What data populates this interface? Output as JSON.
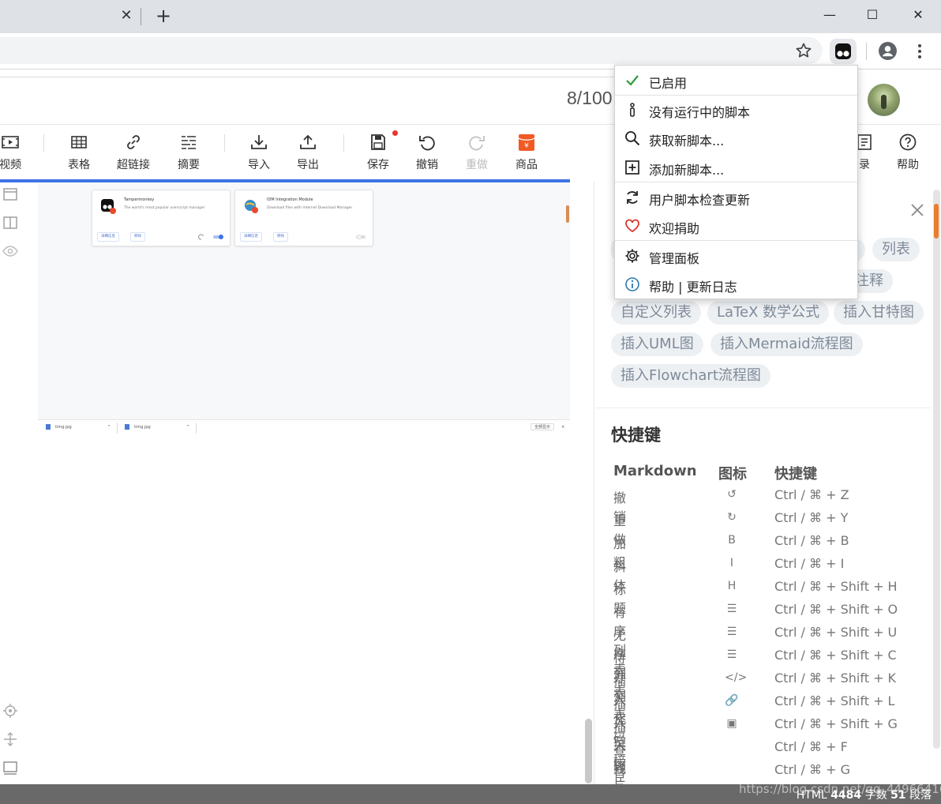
{
  "tab": {
    "close_glyph": "✕",
    "new_tab_glyph": "+"
  },
  "window": {
    "minimize": "—",
    "maximize": "☐",
    "close": "✕"
  },
  "editor": {
    "word_count": "8/100",
    "toolbar": [
      {
        "label": "视频",
        "icon": "video-icon"
      },
      {
        "label": "表格",
        "icon": "table-icon"
      },
      {
        "label": "超链接",
        "icon": "link-icon"
      },
      {
        "label": "摘要",
        "icon": "summary-icon"
      },
      {
        "label": "导入",
        "icon": "import-icon"
      },
      {
        "label": "导出",
        "icon": "export-icon"
      },
      {
        "label": "保存",
        "icon": "save-icon"
      },
      {
        "label": "撤销",
        "icon": "undo-icon"
      },
      {
        "label": "重做",
        "icon": "redo-icon"
      },
      {
        "label": "商品",
        "icon": "product-icon"
      },
      {
        "label": "录",
        "icon": "catalog-icon"
      },
      {
        "label": "帮助",
        "icon": "help-icon"
      }
    ],
    "accent_color": "#3f73e6"
  },
  "preview": {
    "cards": [
      {
        "name": "Tampermonkey",
        "desc": "The world's most popular userscript manager",
        "buttons": [
          "详细信息",
          "移除"
        ],
        "enabled": true
      },
      {
        "name": "IDM Integration Module",
        "desc": "Download files with Internet Download Manager",
        "buttons": [
          "详细信息",
          "移除"
        ],
        "enabled": false
      }
    ],
    "downloads": [
      "timg.jpg",
      "timg.jpg"
    ],
    "show_all": "全部显示"
  },
  "menu": {
    "items": [
      {
        "label": "已启用",
        "icon": "check-icon"
      },
      {
        "label": "没有运行中的脚本",
        "icon": "info-exclamation-icon"
      },
      {
        "label": "获取新脚本...",
        "icon": "search-icon"
      },
      {
        "label": "添加新脚本...",
        "icon": "add-box-icon"
      },
      {
        "label": "用户脚本检查更新",
        "icon": "refresh-icon"
      },
      {
        "label": "欢迎捐助",
        "icon": "heart-icon"
      },
      {
        "label": "管理面板",
        "icon": "gear-icon"
      },
      {
        "label": "帮助 | 更新日志",
        "icon": "info-circle-icon"
      }
    ]
  },
  "right_panel": {
    "chips": [
      {
        "label": "列表"
      },
      {
        "label": "注释"
      },
      {
        "label": "自定义列表"
      },
      {
        "label": "LaTeX 数学公式"
      },
      {
        "label": "插入甘特图"
      },
      {
        "label": "插入UML图"
      },
      {
        "label": "插入Mermaid流程图"
      },
      {
        "label": "插入Flowchart流程图"
      }
    ],
    "shortcuts_title": "快捷键",
    "headers": {
      "markdown": "Markdown",
      "icon": "图标",
      "shortcut": "快捷键"
    },
    "rows": [
      {
        "name": "撤销",
        "icon": "↺",
        "keys": "Ctrl / ⌘ + Z"
      },
      {
        "name": "重做",
        "icon": "↻",
        "keys": "Ctrl / ⌘ + Y"
      },
      {
        "name": "加粗",
        "icon": "B",
        "keys": "Ctrl / ⌘ + B"
      },
      {
        "name": "斜体",
        "icon": "I",
        "keys": "Ctrl / ⌘ + I"
      },
      {
        "name": "标题",
        "icon": "H",
        "keys": "Ctrl / ⌘ + Shift + H"
      },
      {
        "name": "有序列表",
        "icon": "☰",
        "keys": "Ctrl / ⌘ + Shift + O"
      },
      {
        "name": "无序列表",
        "icon": "☰",
        "keys": "Ctrl / ⌘ + Shift + U"
      },
      {
        "name": "待办列表",
        "icon": "☰",
        "keys": "Ctrl / ⌘ + Shift + C"
      },
      {
        "name": "插入代码",
        "icon": "</>",
        "keys": "Ctrl / ⌘ + Shift + K"
      },
      {
        "name": "插入链接",
        "icon": "🔗",
        "keys": "Ctrl / ⌘ + Shift + L"
      },
      {
        "name": "插入图片",
        "icon": "▣",
        "keys": "Ctrl / ⌘ + Shift + G"
      },
      {
        "name": "查找",
        "icon": "",
        "keys": "Ctrl / ⌘ + F"
      },
      {
        "name": "替换",
        "icon": "",
        "keys": "Ctrl / ⌘ + G"
      }
    ]
  },
  "status": {
    "mode": "HTML",
    "words_value": "4484",
    "words_label": "字数",
    "paragraphs_value": "51",
    "paragraphs_label": "段落"
  },
  "watermark": "https://blog.csdn.net/qq_44966416"
}
